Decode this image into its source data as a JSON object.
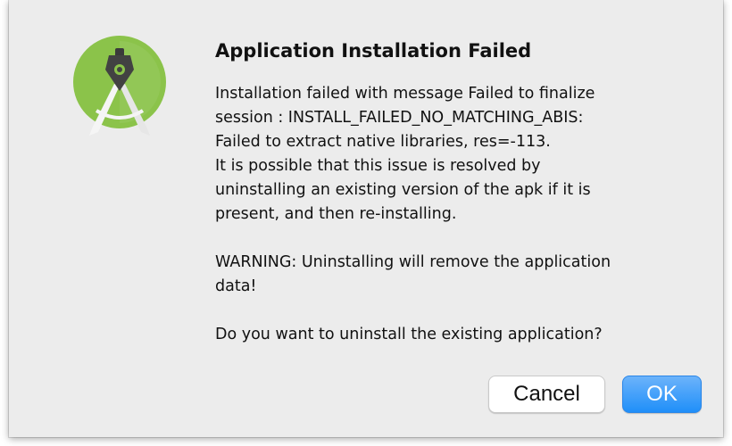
{
  "dialog": {
    "title": "Application Installation Failed",
    "message_lines": [
      "Installation failed with message Failed to finalize",
      "session : INSTALL_FAILED_NO_MATCHING_ABIS:",
      "Failed to extract native libraries, res=-113.",
      "It is possible that this issue is resolved by",
      "uninstalling an existing version of the apk if it is",
      "present, and then re-installing."
    ],
    "warning_lines": [
      "WARNING: Uninstalling will remove the application",
      "data!"
    ],
    "question": "Do you want to uninstall the existing application?",
    "app_icon": "android-studio-icon",
    "buttons": {
      "cancel_label": "Cancel",
      "ok_label": "OK"
    },
    "colors": {
      "background": "#ececec",
      "icon_green": "#8bc34a",
      "ok_button": "#1f8ff9"
    }
  }
}
